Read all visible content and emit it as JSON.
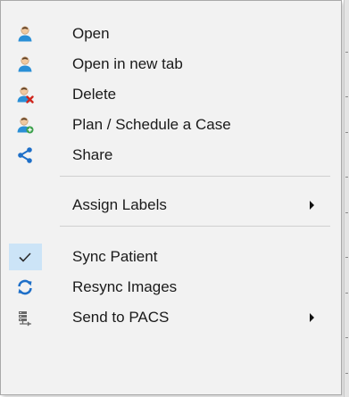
{
  "menu": {
    "items": [
      {
        "label": "Open",
        "icon": "user-icon"
      },
      {
        "label": "Open in new tab",
        "icon": "user-icon"
      },
      {
        "label": "Delete",
        "icon": "user-delete-icon"
      },
      {
        "label": "Plan / Schedule a Case",
        "icon": "user-add-icon"
      },
      {
        "label": "Share",
        "icon": "share-icon"
      },
      {
        "label": "Assign Labels",
        "icon": "",
        "submenu": true
      },
      {
        "label": "Sync Patient",
        "icon": "checkmark-icon",
        "checked": true
      },
      {
        "label": "Resync Images",
        "icon": "refresh-icon"
      },
      {
        "label": "Send to PACS",
        "icon": "pacs-server-icon",
        "submenu": true
      }
    ]
  },
  "colors": {
    "menu_background": "#f2f2f2",
    "check_highlight": "#cce4f7",
    "accent_blue": "#1e6fc8",
    "delete_red": "#d0261d",
    "add_green": "#3aa04a"
  }
}
